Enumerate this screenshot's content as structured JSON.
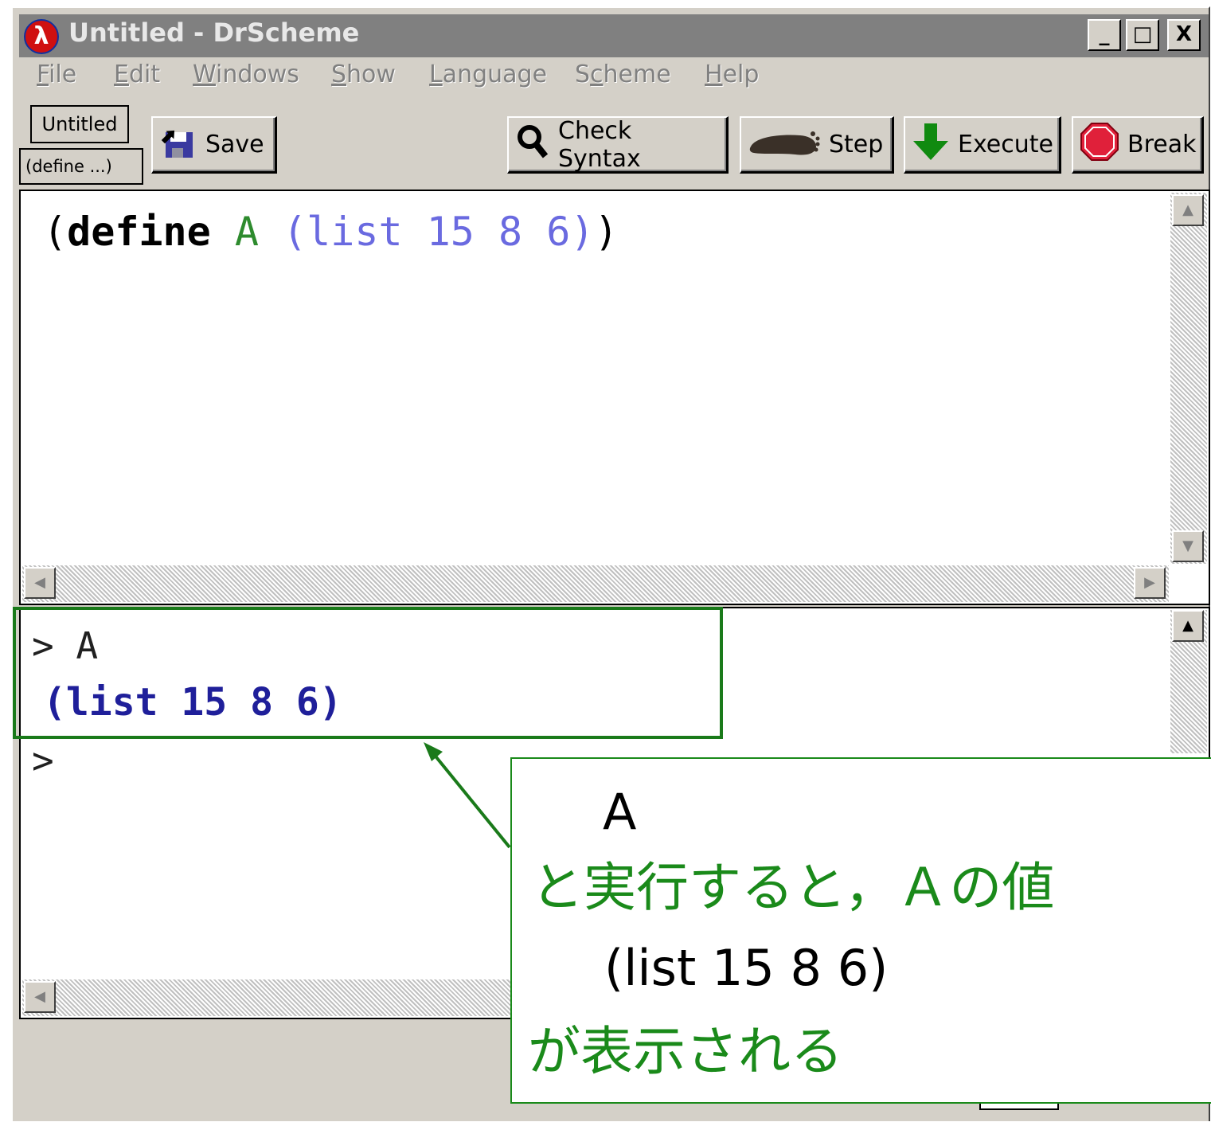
{
  "window": {
    "title": "Untitled - DrScheme",
    "app_icon_glyph": "λ",
    "controls": {
      "minimize": "_",
      "maximize": "□",
      "close": "X"
    }
  },
  "menubar": [
    {
      "label": "File",
      "mnemonic": "F",
      "rest": "ile"
    },
    {
      "label": "Edit",
      "mnemonic": "E",
      "rest": "dit"
    },
    {
      "label": "Windows",
      "mnemonic": "W",
      "rest": "indows"
    },
    {
      "label": "Show",
      "mnemonic": "S",
      "rest": "how"
    },
    {
      "label": "Language",
      "mnemonic": "L",
      "rest": "anguage"
    },
    {
      "label": "Scheme",
      "pre": "S",
      "mnemonic": "c",
      "rest": "heme"
    },
    {
      "label": "Help",
      "mnemonic": "H",
      "rest": "elp"
    }
  ],
  "toolbar": {
    "file_tab": "Untitled",
    "define_menu": "(define ...)",
    "save": "Save",
    "check_syntax": "Check Syntax",
    "step": "Step",
    "execute": "Execute",
    "break": "Break"
  },
  "definitions": {
    "open_paren": "(",
    "keyword": "define",
    "name": "A",
    "inner_open": "(",
    "fn": "list",
    "n1": "15",
    "n2": "8",
    "n3": "6",
    "inner_close": ")",
    "close_paren": ")"
  },
  "interactions": {
    "prompt1": ">",
    "input": "A",
    "result": "(list 15 8 6)",
    "prompt2": ">"
  },
  "callout": {
    "line1": "A",
    "line2": "と実行すると，Ａの値",
    "line3": "(list 15 8 6)",
    "line4": "が表示される"
  },
  "colors": {
    "keyword": "#000000",
    "identifier": "#2e8b2e",
    "constant": "#6a6ae0",
    "result": "#1f1f9a",
    "annotation": "#1a8a1a",
    "title_bar": "#808080",
    "window_bg": "#d4d0c8"
  }
}
